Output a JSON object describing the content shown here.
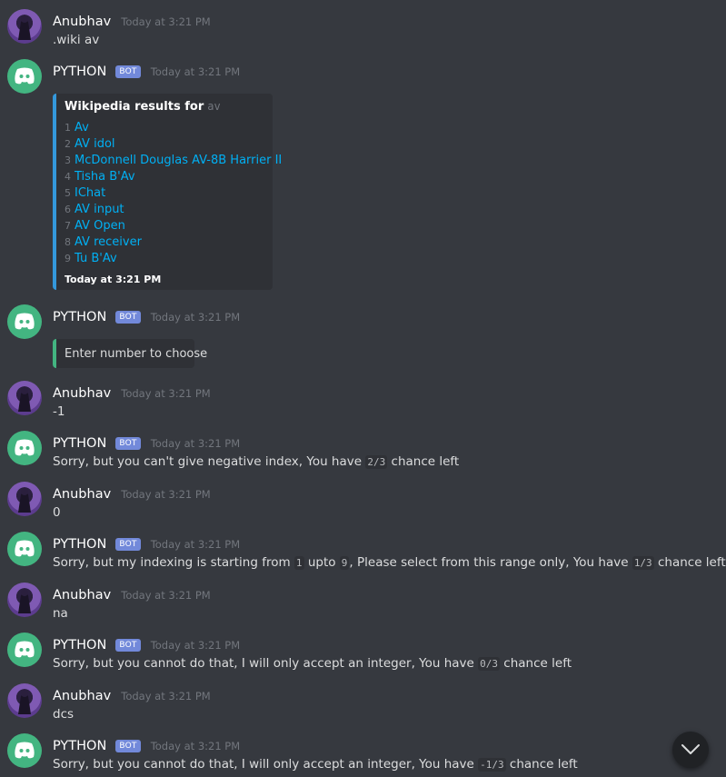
{
  "messages": [
    {
      "author": "Anubhav",
      "time": "Today at 3:21 PM",
      "text": ".wiki av"
    },
    {
      "author": "PYTHON",
      "badge": "BOT",
      "time": "Today at 3:21 PM",
      "embed": {
        "title": "Wikipedia results for",
        "query": "av",
        "results": [
          {
            "n": "1",
            "title": "Av"
          },
          {
            "n": "2",
            "title": "AV idol"
          },
          {
            "n": "3",
            "title": "McDonnell Douglas AV-8B Harrier II"
          },
          {
            "n": "4",
            "title": "Tisha B'Av"
          },
          {
            "n": "5",
            "title": "IChat"
          },
          {
            "n": "6",
            "title": "AV input"
          },
          {
            "n": "7",
            "title": "AV Open"
          },
          {
            "n": "8",
            "title": "AV receiver"
          },
          {
            "n": "9",
            "title": "Tu B'Av"
          }
        ],
        "footer": "Today at 3:21 PM"
      }
    },
    {
      "author": "PYTHON",
      "badge": "BOT",
      "time": "Today at 3:21 PM",
      "embed": {
        "description": "Enter number to choose"
      }
    },
    {
      "author": "Anubhav",
      "time": "Today at 3:21 PM",
      "text": "-1"
    },
    {
      "author": "PYTHON",
      "badge": "BOT",
      "time": "Today at 3:21 PM",
      "text_parts": [
        "Sorry, but you can't give negative index, You have ",
        "2/3",
        " chance left"
      ]
    },
    {
      "author": "Anubhav",
      "time": "Today at 3:21 PM",
      "text": "0"
    },
    {
      "author": "PYTHON",
      "badge": "BOT",
      "time": "Today at 3:21 PM",
      "text_parts": [
        "Sorry, but my indexing is starting from ",
        "1",
        " upto ",
        "9",
        ", Please select from this range only, You have ",
        "1/3",
        " chance left"
      ]
    },
    {
      "author": "Anubhav",
      "time": "Today at 3:21 PM",
      "text": "na"
    },
    {
      "author": "PYTHON",
      "badge": "BOT",
      "time": "Today at 3:21 PM",
      "text_parts": [
        "Sorry, but you cannot do that, I will only accept an integer, You have ",
        "0/3",
        " chance left"
      ]
    },
    {
      "author": "Anubhav",
      "time": "Today at 3:21 PM",
      "text": "dcs"
    },
    {
      "author": "PYTHON",
      "badge": "BOT",
      "time": "Today at 3:21 PM",
      "text_parts": [
        "Sorry, but you cannot do that, I will only accept an integer, You have ",
        "-1/3",
        " chance left"
      ]
    }
  ],
  "icons": {
    "user_avatar": "user-avatar-icon",
    "bot_avatar": "discord-logo-icon",
    "scroll_button": "chevron-down-icon"
  },
  "colors": {
    "background": "#36393f",
    "bot_badge": "#7289da",
    "link": "#00b0f4",
    "embed_border_blue": "#3498db",
    "embed_border_green": "#43b581",
    "bot_avatar": "#43b581"
  }
}
